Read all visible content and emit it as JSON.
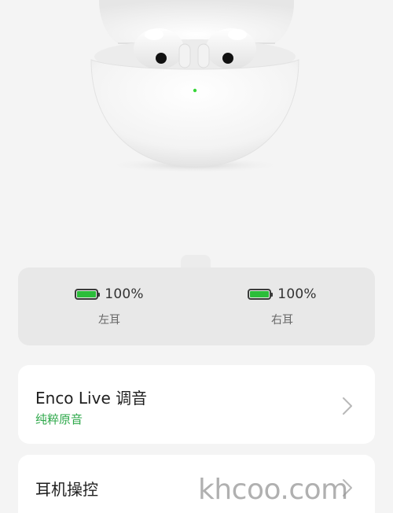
{
  "device": {
    "image_name": "earbuds-case-image"
  },
  "battery": {
    "left": {
      "percent_text": "100%",
      "label": "左耳",
      "level": 1.0
    },
    "right": {
      "percent_text": "100%",
      "label": "右耳",
      "level": 1.0
    }
  },
  "settings": [
    {
      "title": "Enco Live 调音",
      "subtitle": "纯粹原音"
    },
    {
      "title": "耳机操控"
    }
  ],
  "colors": {
    "background": "#f4f4f4",
    "battery_fill": "#2bbd3a",
    "accent_green": "#2ea84a",
    "card": "#ffffff",
    "battery_card": "#e8e8e8"
  },
  "icons": [
    "battery-icon",
    "chevron-right-icon"
  ],
  "watermark": "khcoo.com"
}
